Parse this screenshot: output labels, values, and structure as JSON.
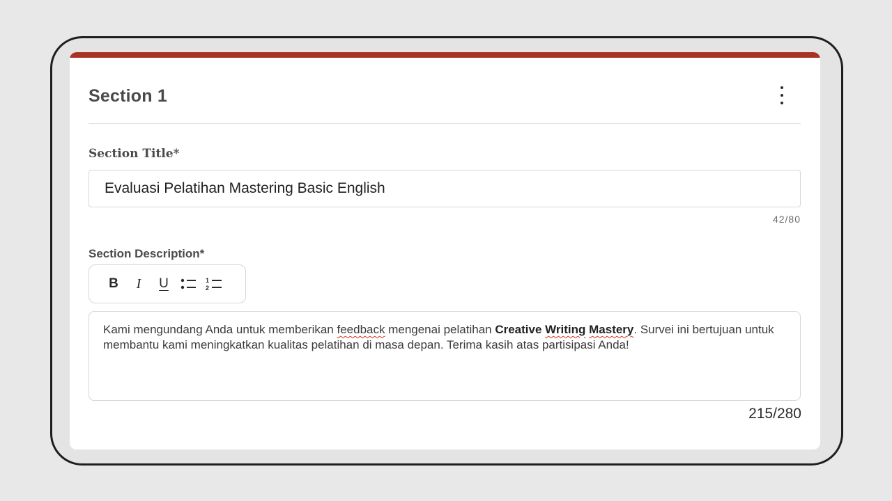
{
  "section": {
    "heading": "Section 1",
    "more_icon": "more-vert-icon"
  },
  "title_field": {
    "label": "Section Title*",
    "value": "Evaluasi Pelatihan Mastering Basic English",
    "counter": "42/80"
  },
  "description_field": {
    "label": "Section Description*",
    "toolbar": {
      "bold_label": "B",
      "italic_label": "I",
      "underline_label": "U",
      "bullet_icon": "bulleted-list-icon",
      "numbered_icon": "numbered-list-icon"
    },
    "text": {
      "part1": "Kami mengundang Anda untuk memberikan ",
      "spell1": "feedback",
      "part2": " mengenai pelatihan ",
      "bold1": "Creative ",
      "bold_spell1": "Writing",
      "bold_space": " ",
      "bold_spell2": "Mastery",
      "part3": ". Survei ini bertujuan untuk membantu kami meningkatkan kualitas pelatihan di masa depan. Terima kasih atas partisipasi Anda!"
    },
    "counter": "215/280"
  },
  "colors": {
    "accent": "#a83226",
    "page_background": "#e8e8e8",
    "card_background": "#ffffff"
  }
}
